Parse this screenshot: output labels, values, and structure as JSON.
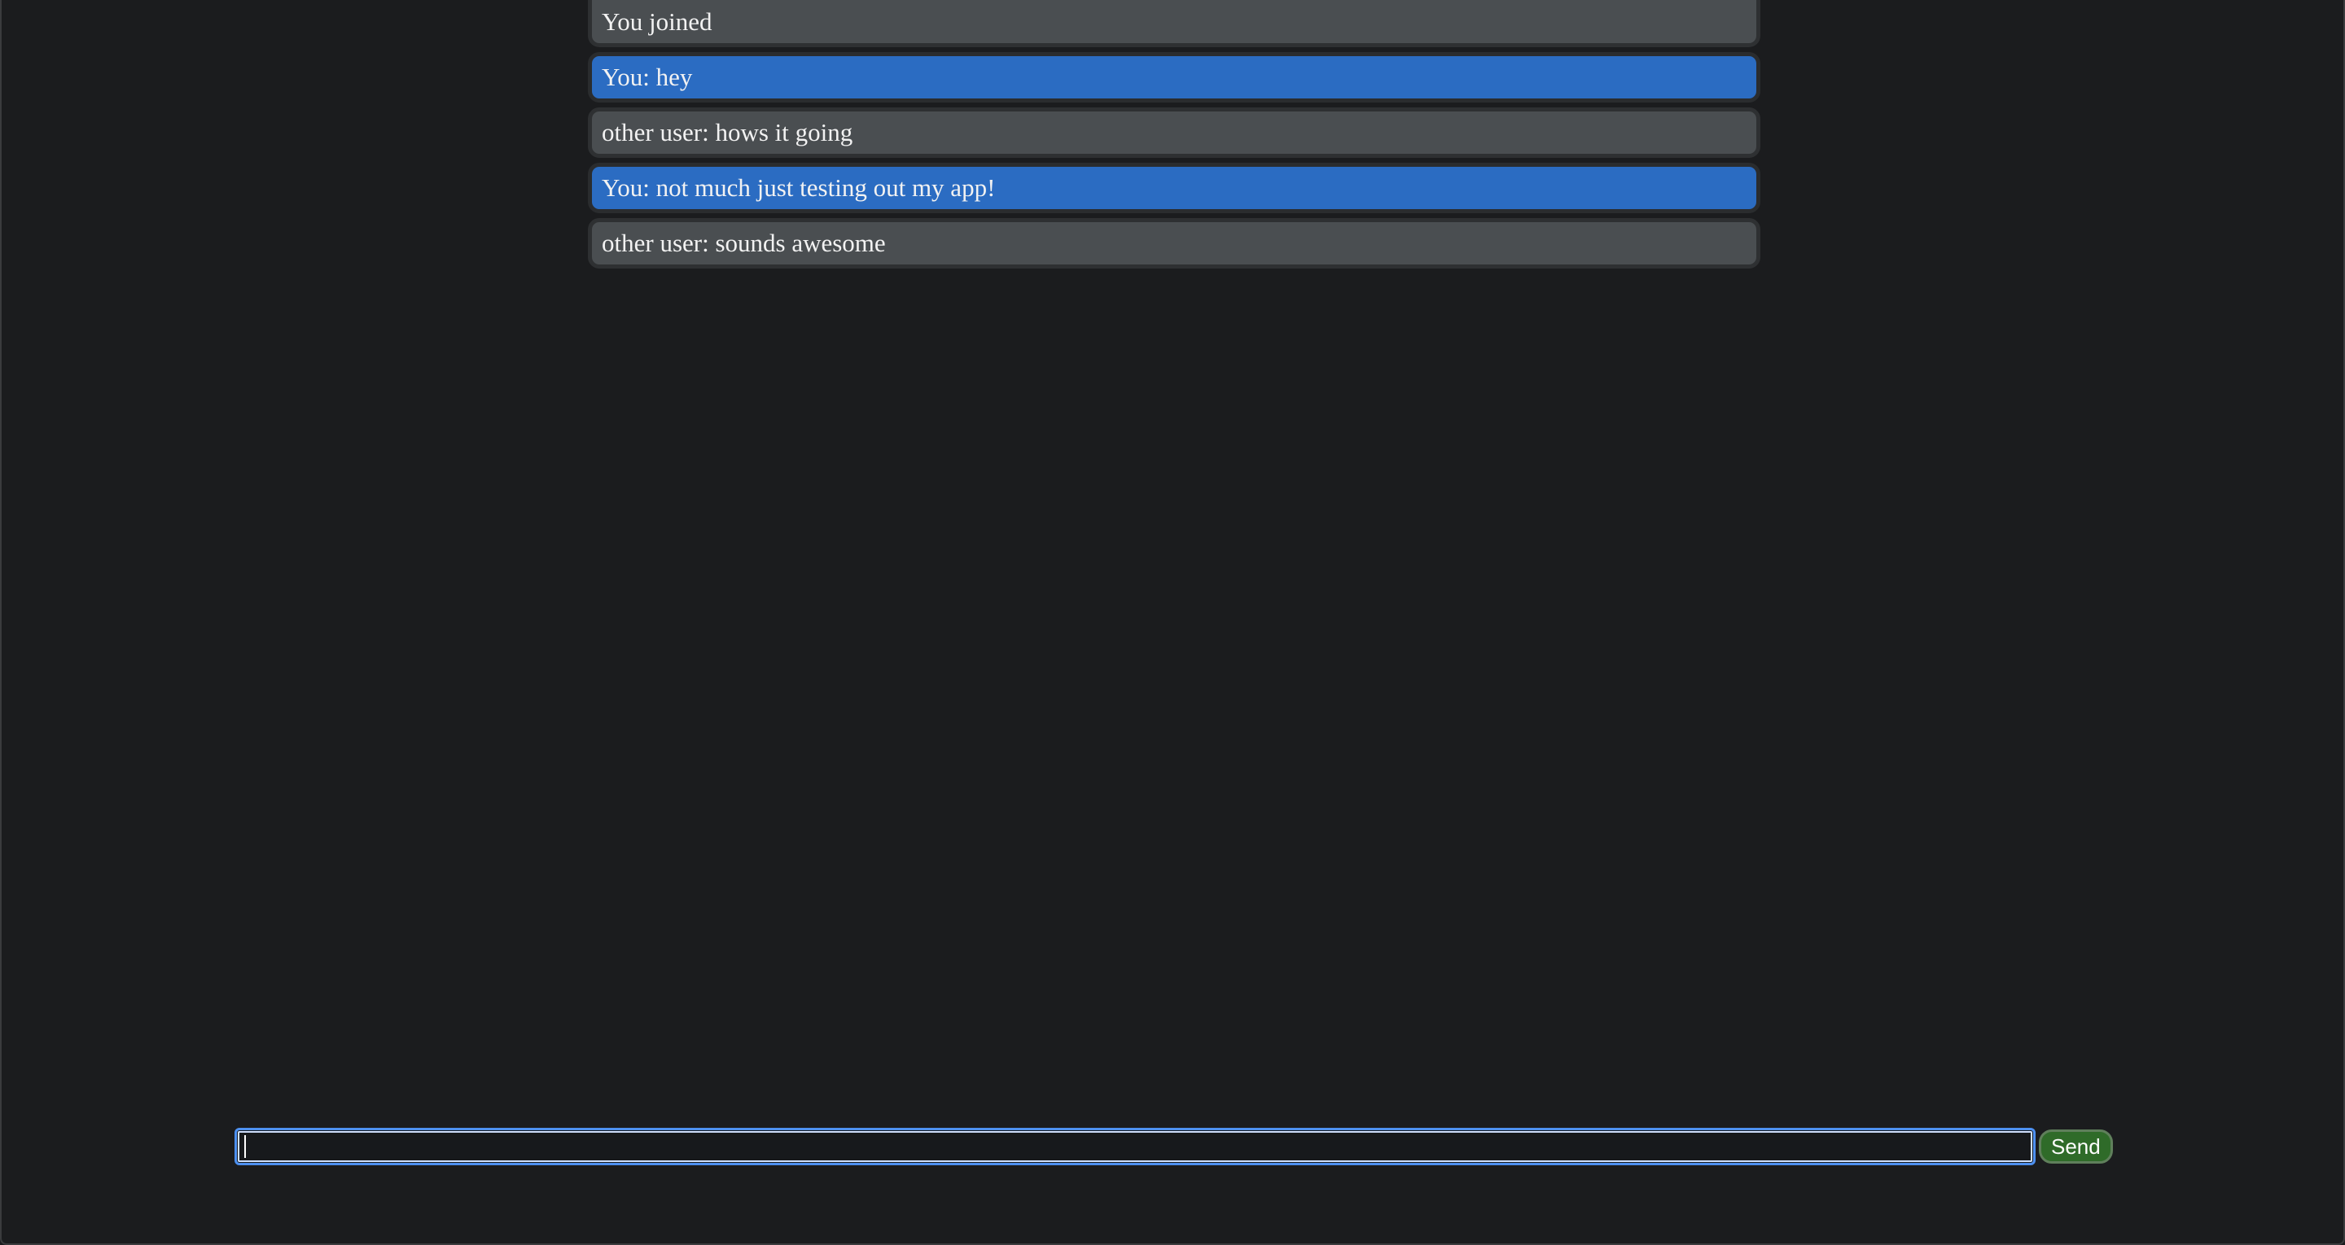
{
  "messages": [
    {
      "text": "You joined",
      "own": false
    },
    {
      "text": "You: hey",
      "own": true
    },
    {
      "text": "other user: hows it going",
      "own": false
    },
    {
      "text": "You: not much just testing out my app!",
      "own": true
    },
    {
      "text": "other user: sounds awesome",
      "own": false
    }
  ],
  "composer": {
    "input_value": "",
    "send_label": "Send"
  },
  "colors": {
    "background": "#1b1c1e",
    "own_message": "#2b6cc2",
    "other_message": "#4a4e51",
    "send_button": "#2f6b29",
    "input_focus": "#4d90f0"
  }
}
